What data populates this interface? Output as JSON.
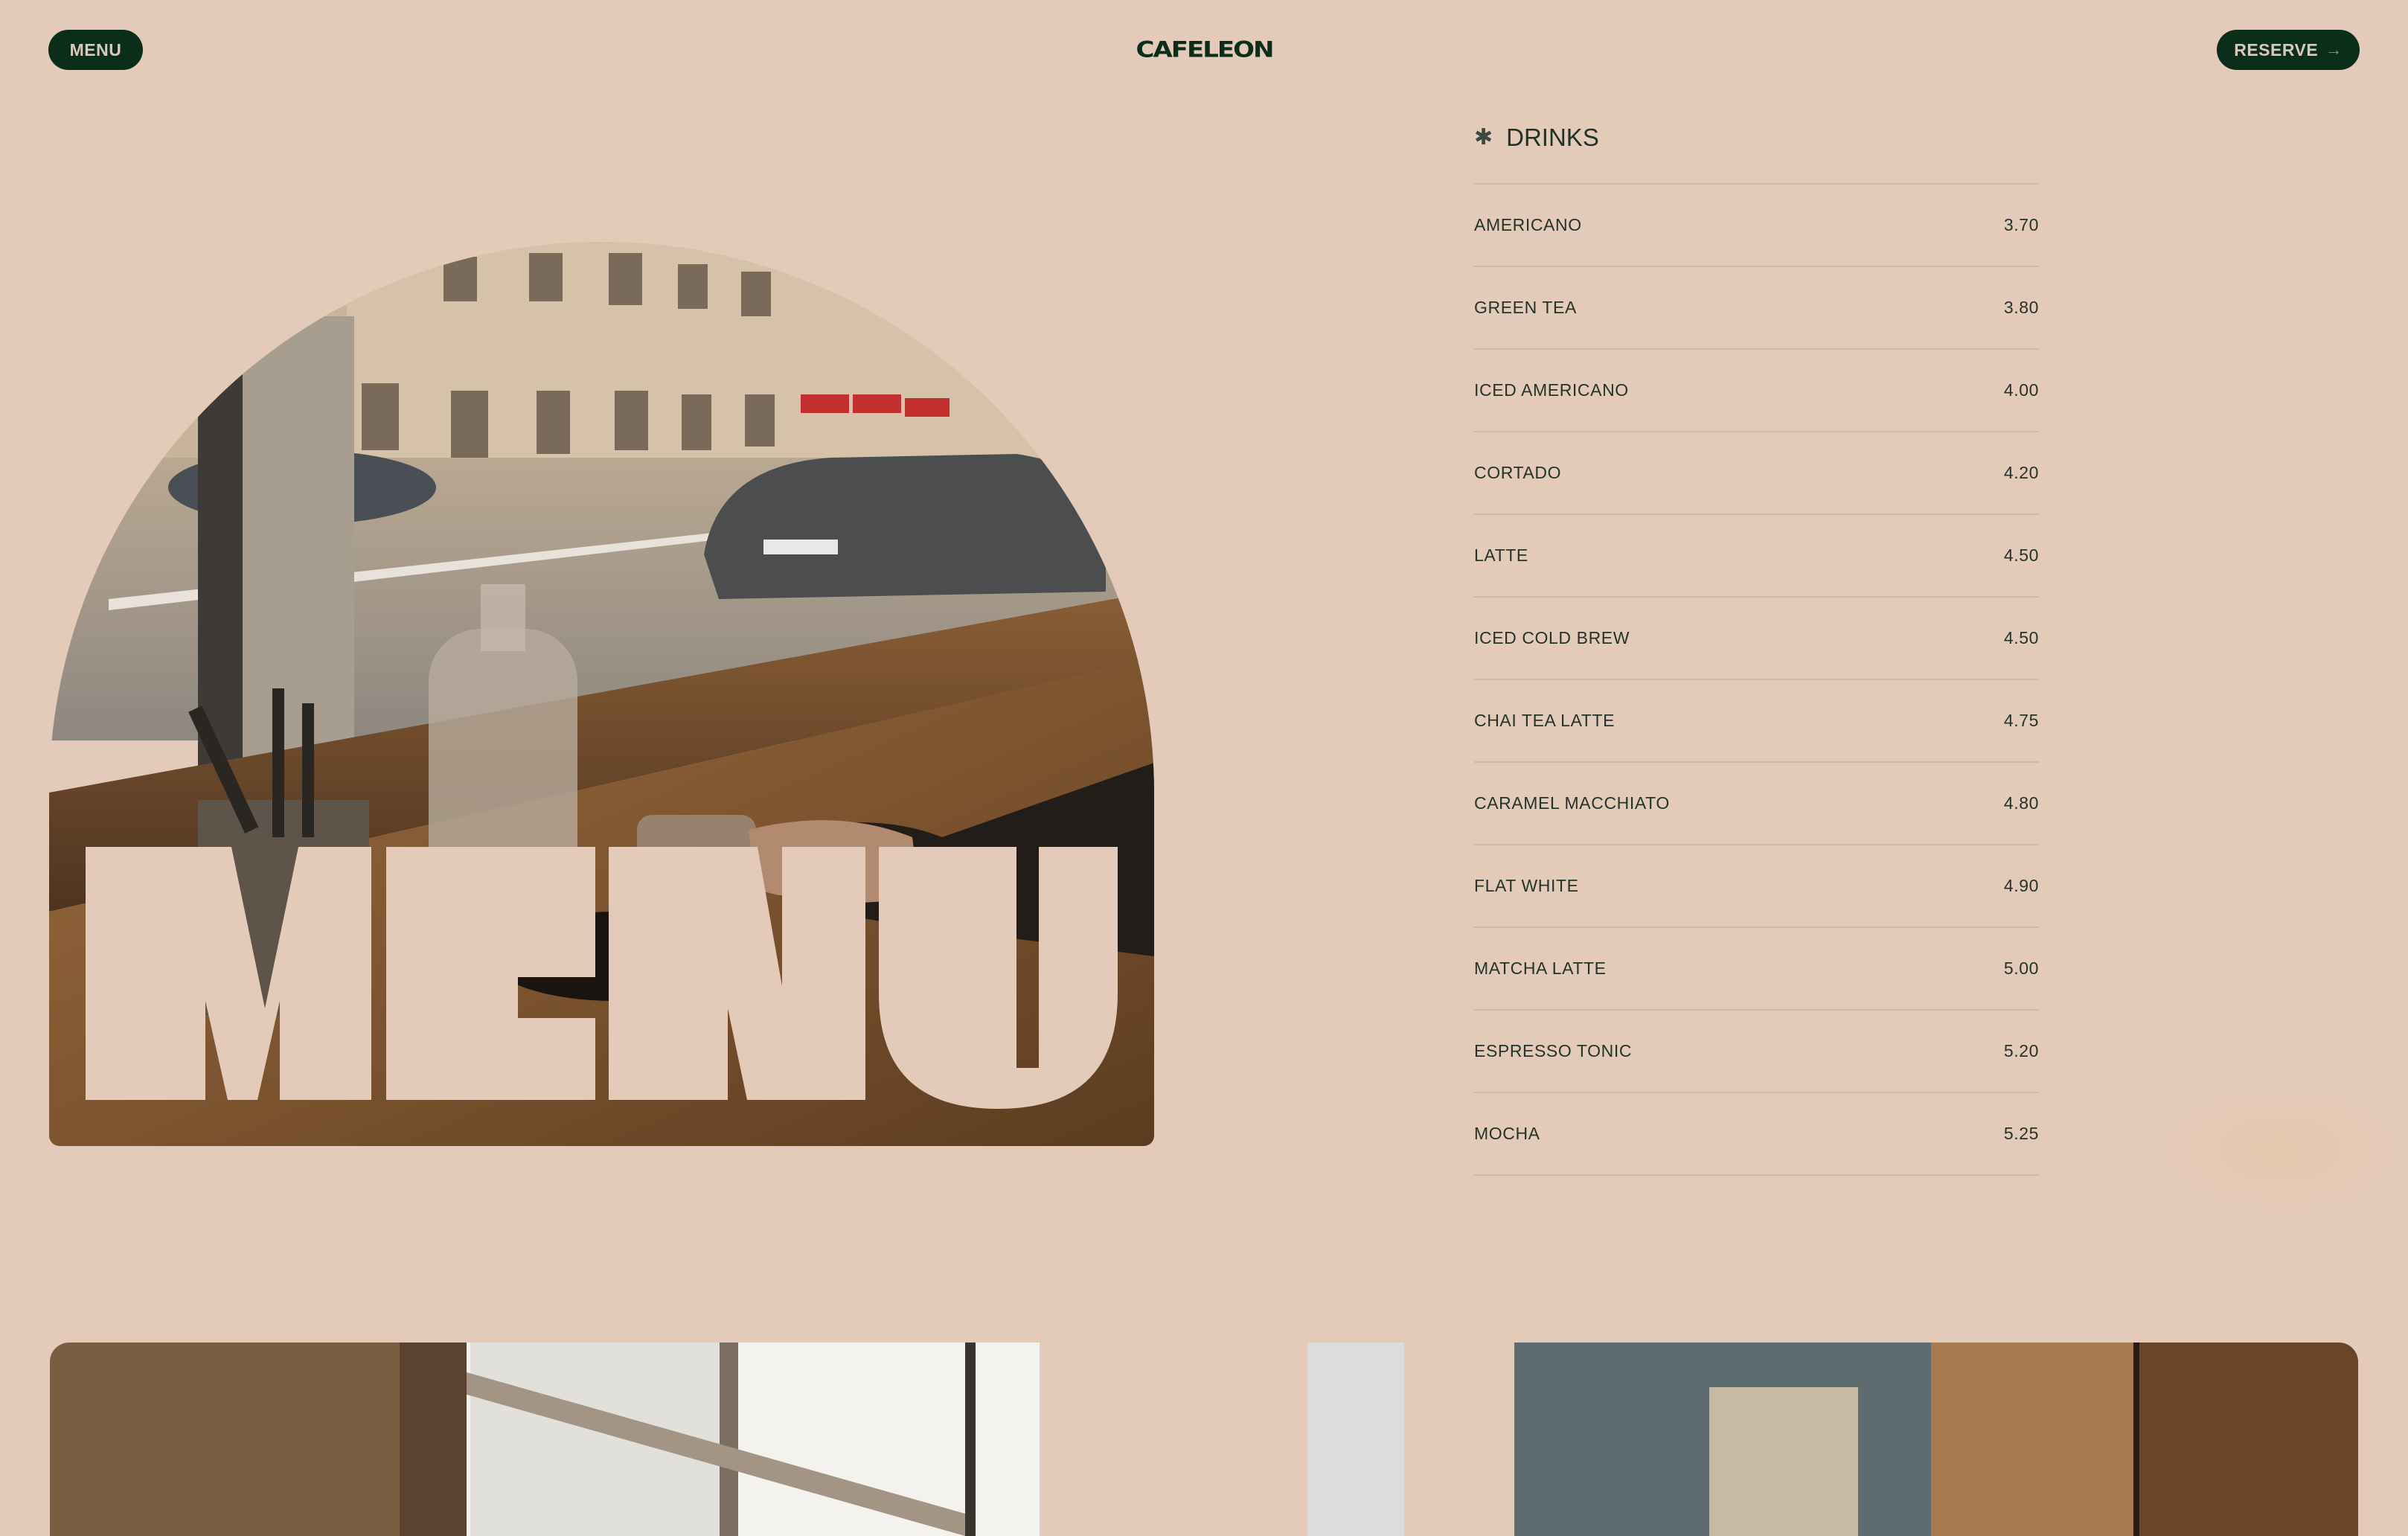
{
  "header": {
    "menu_button": "MENU",
    "logo": "CAFELEON",
    "reserve_button": "RESERVE",
    "reserve_icon": "arrow-right-icon",
    "reserve_icon_glyph": "→"
  },
  "hero": {
    "overlay_text": "MENU",
    "image_alt": "Cafe window table with coffee, water carafe and street view"
  },
  "drinks": {
    "heading": "DRINKS",
    "heading_icon": "asterisk-icon",
    "heading_icon_glyph": "✱",
    "items": [
      {
        "name": "AMERICANO",
        "price": "3.70"
      },
      {
        "name": "GREEN TEA",
        "price": "3.80"
      },
      {
        "name": "ICED AMERICANO",
        "price": "4.00"
      },
      {
        "name": "CORTADO",
        "price": "4.20"
      },
      {
        "name": "LATTE",
        "price": "4.50"
      },
      {
        "name": "ICED COLD BREW",
        "price": "4.50"
      },
      {
        "name": "CHAI TEA LATTE",
        "price": "4.75"
      },
      {
        "name": "CARAMEL MACCHIATO",
        "price": "4.80"
      },
      {
        "name": "FLAT WHITE",
        "price": "4.90"
      },
      {
        "name": "MATCHA LATTE",
        "price": "5.00"
      },
      {
        "name": "ESPRESSO TONIC",
        "price": "5.20"
      },
      {
        "name": "MOCHA",
        "price": "5.25"
      }
    ]
  },
  "colors": {
    "background": "#e4cab8",
    "brand_green": "#0b2e1a",
    "text": "#1d3327",
    "divider": "#d6b8a6"
  }
}
